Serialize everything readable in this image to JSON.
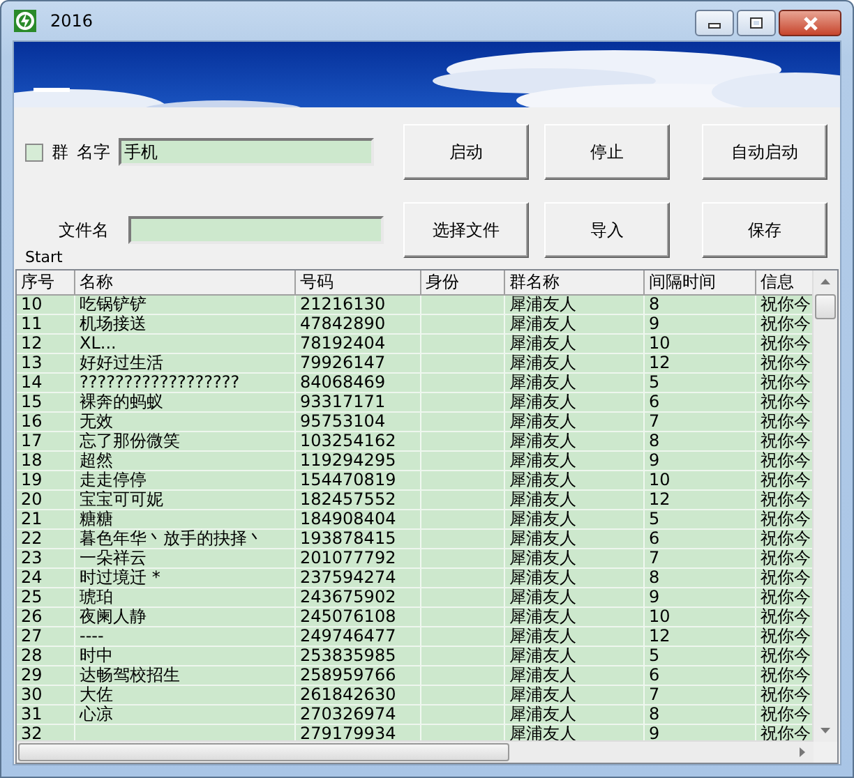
{
  "window": {
    "title": "2016"
  },
  "form": {
    "group_checkbox": {
      "label": "群",
      "checked": false
    },
    "name_label": "名字",
    "name_value": "手机",
    "file_label": "文件名",
    "status": "Start"
  },
  "buttons": [
    {
      "label": "启动"
    },
    {
      "label": "停止"
    },
    {
      "label": "自动启动"
    },
    {
      "label": "选择文件"
    },
    {
      "label": "导入"
    },
    {
      "label": "保存"
    }
  ],
  "table": {
    "columns": [
      "序号",
      "名称",
      "号码",
      "身份",
      "群名称",
      "间隔时间",
      "信息"
    ],
    "rows": [
      {
        "no": "10",
        "name": "吃锅铲铲",
        "number": "21216130",
        "group": "犀浦友人",
        "interval": "8",
        "info": "祝你今"
      },
      {
        "no": "11",
        "name": "机场接送",
        "number": "47842890",
        "group": "犀浦友人",
        "interval": "9",
        "info": "祝你今"
      },
      {
        "no": "12",
        "name": "XL...",
        "number": "78192404",
        "group": "犀浦友人",
        "interval": "10",
        "info": "祝你今"
      },
      {
        "no": "13",
        "name": "好好过生活",
        "number": "79926147",
        "group": "犀浦友人",
        "interval": "12",
        "info": "祝你今"
      },
      {
        "no": "14",
        "name": "??????????????????",
        "number": "84068469",
        "group": "犀浦友人",
        "interval": "5",
        "info": "祝你今"
      },
      {
        "no": "15",
        "name": "裸奔的蚂蚁",
        "number": "93317171",
        "group": "犀浦友人",
        "interval": "6",
        "info": "祝你今"
      },
      {
        "no": "16",
        "name": "无效",
        "number": "95753104",
        "group": "犀浦友人",
        "interval": "7",
        "info": "祝你今"
      },
      {
        "no": "17",
        "name": "忘了那份微笑",
        "number": "103254162",
        "group": "犀浦友人",
        "interval": "8",
        "info": "祝你今"
      },
      {
        "no": "18",
        "name": "超然",
        "number": "119294295",
        "group": "犀浦友人",
        "interval": "9",
        "info": "祝你今"
      },
      {
        "no": "19",
        "name": "走走停停",
        "number": "154470819",
        "group": "犀浦友人",
        "interval": "10",
        "info": "祝你今"
      },
      {
        "no": "20",
        "name": "宝宝可可妮",
        "number": "182457552",
        "group": "犀浦友人",
        "interval": "12",
        "info": "祝你今"
      },
      {
        "no": "21",
        "name": "糖糖",
        "number": "184908404",
        "group": "犀浦友人",
        "interval": "5",
        "info": "祝你今"
      },
      {
        "no": "22",
        "name": "暮色年华丶放手的抉择丶",
        "number": "193878415",
        "group": "犀浦友人",
        "interval": "6",
        "info": "祝你今"
      },
      {
        "no": "23",
        "name": "一朵祥云",
        "number": "201077792",
        "group": "犀浦友人",
        "interval": "7",
        "info": "祝你今"
      },
      {
        "no": "24",
        "name": "时过境迁 *",
        "number": "237594274",
        "group": "犀浦友人",
        "interval": "8",
        "info": "祝你今"
      },
      {
        "no": "25",
        "name": "琥珀",
        "number": "243675902",
        "group": "犀浦友人",
        "interval": "9",
        "info": "祝你今"
      },
      {
        "no": "26",
        "name": "夜阑人静",
        "number": "245076108",
        "group": "犀浦友人",
        "interval": "10",
        "info": "祝你今"
      },
      {
        "no": "27",
        "name": "----",
        "number": "249746477",
        "group": "犀浦友人",
        "interval": "12",
        "info": "祝你今"
      },
      {
        "no": "28",
        "name": "时中",
        "number": "253835985",
        "group": "犀浦友人",
        "interval": "5",
        "info": "祝你今"
      },
      {
        "no": "29",
        "name": "达畅驾校招生",
        "number": "258959766",
        "group": "犀浦友人",
        "interval": "6",
        "info": "祝你今"
      },
      {
        "no": "30",
        "name": "大佐",
        "number": "261842630",
        "group": "犀浦友人",
        "interval": "7",
        "info": "祝你今"
      },
      {
        "no": "31",
        "name": "心凉",
        "number": "270326974",
        "group": "犀浦友人",
        "interval": "8",
        "info": "祝你今"
      },
      {
        "no": "32",
        "number": "279179934",
        "group": "犀浦友人",
        "interval": "9",
        "info": "祝你今"
      }
    ]
  }
}
